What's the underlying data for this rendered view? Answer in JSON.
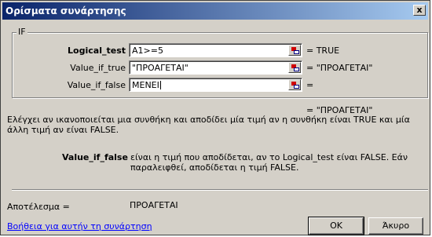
{
  "dialog": {
    "title": "Ορίσματα συνάρτησης",
    "close_glyph": "x"
  },
  "function_group": {
    "name": "IF",
    "arguments": [
      {
        "label": "Logical_test",
        "value": "A1>=5",
        "result": "= TRUE"
      },
      {
        "label": "Value_if_true",
        "value": "\"ΠΡΟΑΓΕΤΑΙ\"",
        "result": "= \"ΠΡΟΑΓΕΤΑΙ\""
      },
      {
        "label": "Value_if_false",
        "value": "ΜΕΝΕΙ",
        "result": "="
      }
    ]
  },
  "formula_result_line": "= \"ΠΡΟΑΓΕΤΑΙ\"",
  "description": "Ελέγχει αν ικανοποιείται μια συνθήκη και αποδίδει μία τιμή αν η συνθήκη είναι TRUE και μία άλλη τιμή αν είναι FALSE.",
  "argument_help": {
    "name": "Value_if_false",
    "text": "είναι η τιμή που αποδίδεται, αν το Logical_test είναι FALSE. Εάν παραλειφθεί, αποδίδεται η τιμή FALSE."
  },
  "result": {
    "label": "Αποτέλεσμα =",
    "value": "ΠΡΟΑΓΕΤΑΙ"
  },
  "help_link": "Βοήθεια για αυτήν τη συνάρτηση",
  "buttons": {
    "ok": "OK",
    "cancel": "Άκυρο"
  },
  "icons": {
    "collapse_dialog": "collapse-dialog-icon",
    "close": "close-icon"
  }
}
